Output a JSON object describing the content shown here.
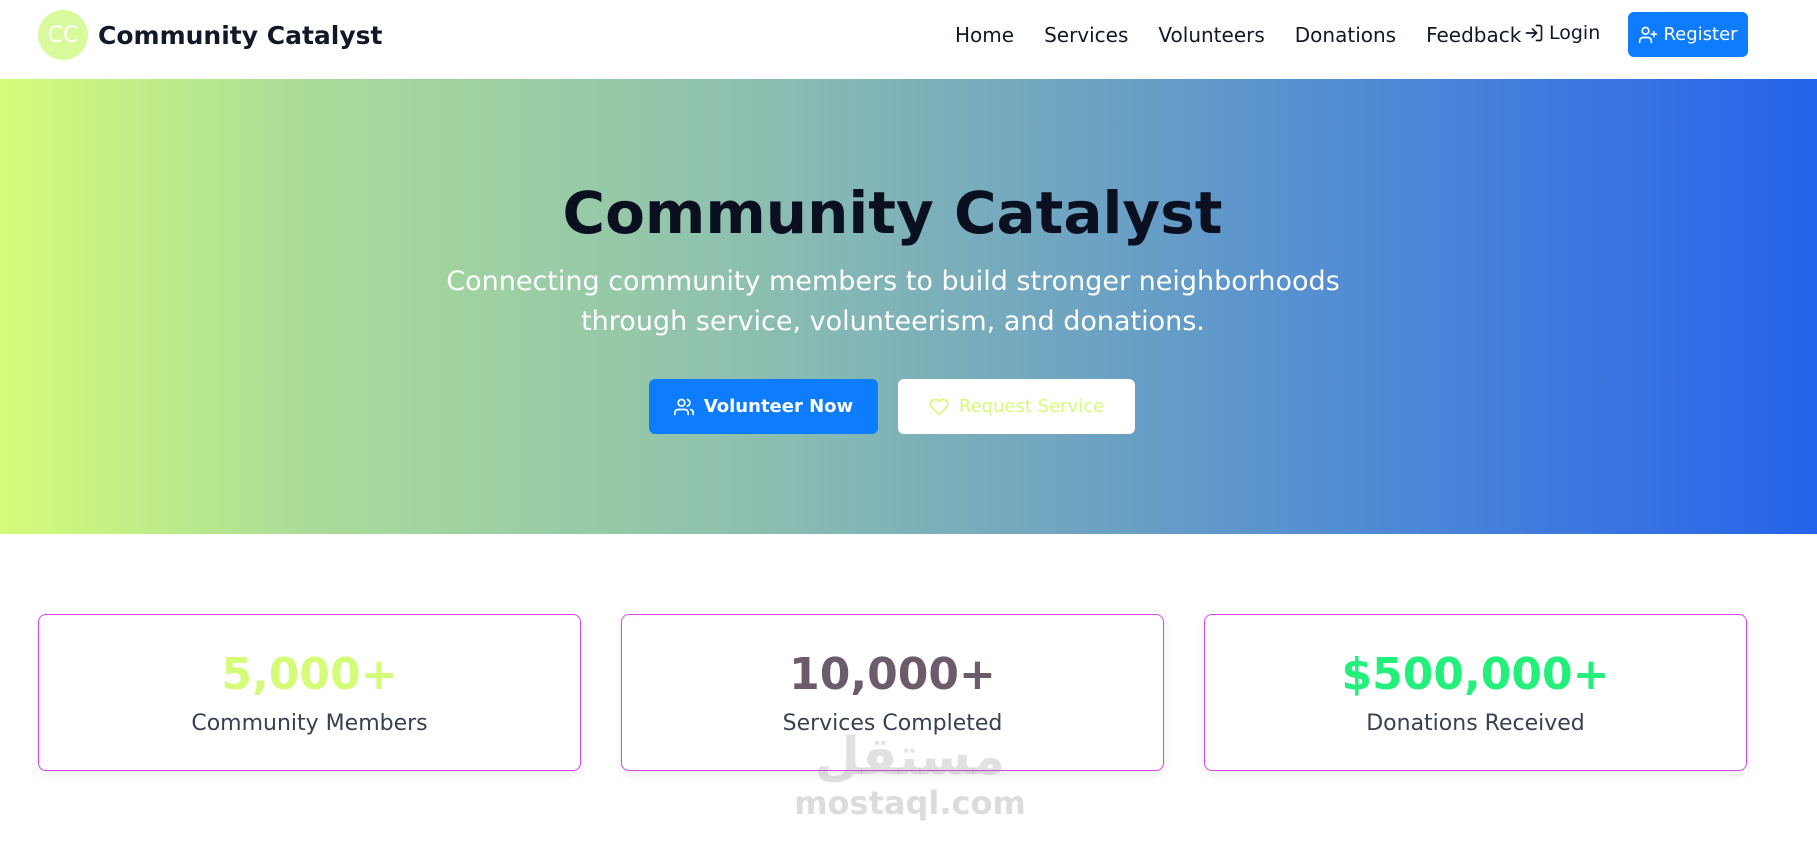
{
  "brand": {
    "logo_text": "CC",
    "name": "Community Catalyst"
  },
  "nav": {
    "links": [
      "Home",
      "Services",
      "Volunteers",
      "Donations",
      "Feedback"
    ],
    "login_label": "Login",
    "register_label": "Register"
  },
  "hero": {
    "title": "Community Catalyst",
    "subtitle": "Connecting community members to build stronger neighborhoods through service, volunteerism, and donations.",
    "volunteer_label": "Volunteer Now",
    "request_label": "Request Service",
    "gradient": [
      "#d4fc79",
      "#2563eb"
    ]
  },
  "stats": [
    {
      "value": "5,000+",
      "label": "Community Members",
      "color": "#d4fc79"
    },
    {
      "value": "10,000+",
      "label": "Services Completed",
      "color": "#6b5b6b"
    },
    {
      "value": "$500,000+",
      "label": "Donations Received",
      "color": "#22f07a"
    }
  ],
  "watermark": {
    "arabic": "مستقل",
    "latin": "mostaql.com"
  },
  "colors": {
    "primary": "#0d7cff",
    "card_border": "#d946ef"
  }
}
